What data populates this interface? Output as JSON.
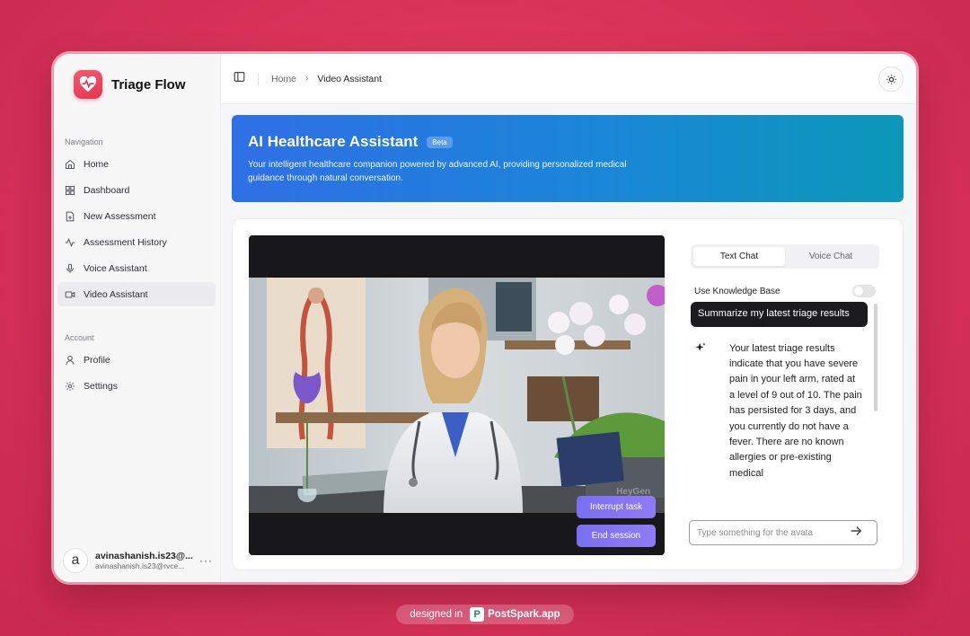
{
  "app": {
    "name": "Triage Flow"
  },
  "sidebar": {
    "navigation_label": "Navigation",
    "account_label": "Account",
    "nav_items": [
      {
        "label": "Home",
        "icon": "home-icon"
      },
      {
        "label": "Dashboard",
        "icon": "dashboard-icon"
      },
      {
        "label": "New Assessment",
        "icon": "file-plus-icon"
      },
      {
        "label": "Assessment History",
        "icon": "activity-icon"
      },
      {
        "label": "Voice Assistant",
        "icon": "mic-icon"
      },
      {
        "label": "Video Assistant",
        "icon": "video-icon",
        "active": true
      }
    ],
    "account_items": [
      {
        "label": "Profile",
        "icon": "user-icon"
      },
      {
        "label": "Settings",
        "icon": "gear-icon"
      }
    ],
    "user": {
      "avatar_letter": "a",
      "name": "avinashanish.is23@...",
      "email": "avinashanish.is23@rvce..."
    }
  },
  "header": {
    "breadcrumb": [
      "Home",
      "Video Assistant"
    ]
  },
  "hero": {
    "title": "AI Healthcare Assistant",
    "badge": "Beta",
    "description": "Your intelligent healthcare companion powered by advanced AI, providing personalized medical guidance through natural conversation."
  },
  "video": {
    "watermark": "HeyGen",
    "interrupt_label": "Interrupt task",
    "end_label": "End session"
  },
  "chat": {
    "tabs": [
      "Text Chat",
      "Voice Chat"
    ],
    "active_tab": "Text Chat",
    "knowledge_base_label": "Use Knowledge Base",
    "knowledge_base_enabled": false,
    "user_message": "Summarize my latest triage results",
    "ai_message": "Your latest triage results indicate that you have severe pain in your left arm, rated at a level of 9 out of 10. The pain has persisted for 3 days, and you currently do not have a fever. There are no known allergies or pre-existing medical",
    "input_placeholder": "Type something for the avata"
  },
  "footer": {
    "prefix": "designed in",
    "brand": "PostSpark.app"
  },
  "colors": {
    "accent": "#7a6ff2",
    "brand": "#e33553",
    "hero_start": "#2f6fe6",
    "hero_end": "#0b98b8"
  }
}
